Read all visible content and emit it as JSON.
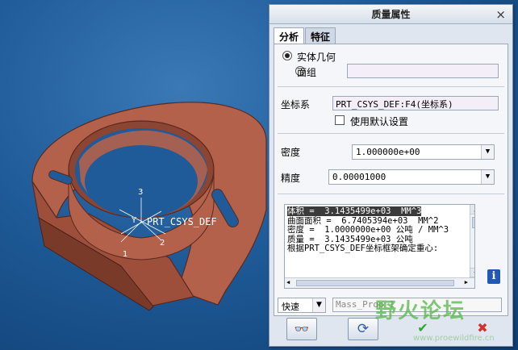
{
  "viewport": {
    "csys_label": "PRT_CSYS_DEF",
    "axis_labels": [
      "3",
      "Y",
      "1",
      "2"
    ]
  },
  "dialog": {
    "title": "质量属性",
    "close_glyph": "×",
    "tabs": [
      {
        "label": "分析",
        "active": true
      },
      {
        "label": "特征",
        "active": false
      }
    ],
    "geometry": {
      "solid_label": "实体几何",
      "surface_label": "面组",
      "surface_value": ""
    },
    "csys": {
      "label": "坐标系",
      "value": "PRT_CSYS_DEF:F4(坐标系)",
      "default_label": "使用默认设置"
    },
    "density": {
      "label": "密度",
      "value": "1.000000e+00"
    },
    "accuracy": {
      "label": "精度",
      "value": "0.00001000"
    },
    "results": {
      "lines": [
        "体积 =  3.1435499e+03  MM^3",
        "曲面面积 =  6.7405394e+03  MM^2",
        "密度 =  1.0000000e+00 公吨 / MM^3",
        "质量 =  3.1435499e+03 公吨",
        "",
        "根据PRT_CSYS_DEF坐标框架确定重心:"
      ]
    },
    "info_glyph": "i",
    "mode": {
      "value": "快速",
      "name_value": "Mass_Prop_1"
    },
    "buttons": {
      "preview": "👓",
      "repeat": "⟳",
      "ok": "✔",
      "cancel": "✖"
    }
  },
  "watermark": {
    "text": "野火论坛",
    "url": "www.proewildfire.cn"
  },
  "colors": {
    "part": "#b4614c",
    "part_dark": "#7a3a2a",
    "ok": "#2aa830",
    "cancel": "#d03030"
  }
}
